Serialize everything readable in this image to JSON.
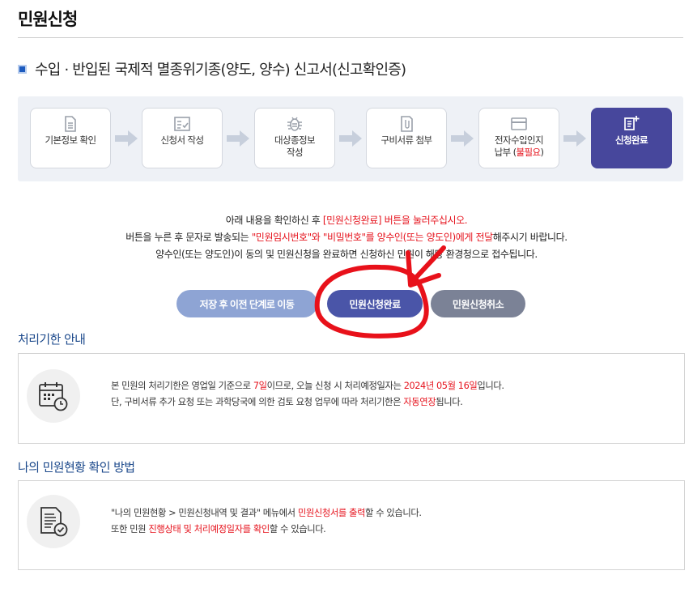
{
  "page_title": "민원신청",
  "form_title": "수입 · 반입된 국제적 멸종위기종(양도, 양수) 신고서(신고확인증)",
  "steps": [
    {
      "label": "기본정보 확인",
      "icon": "document-icon"
    },
    {
      "label": "신청서 작성",
      "icon": "checklist-icon"
    },
    {
      "label_line1": "대상종정보",
      "label_line2": "작성",
      "icon": "bug-icon"
    },
    {
      "label": "구비서류 첨부",
      "icon": "attachment-icon"
    },
    {
      "label_line1": "전자수입인지",
      "label_line2_prefix": "납부 (",
      "label_line2_red": "불필요",
      "label_line2_suffix": ")",
      "icon": "card-icon"
    },
    {
      "label": "신청완료",
      "icon": "note-plus-icon",
      "active": true
    }
  ],
  "notice": {
    "l1_a": "아래 내용을 확인하신 후 ",
    "l1_red": "[민원신청완료] 버튼을 눌러주십시오.",
    "l2_a": "버튼을 누른 후 문자로 발송되는 ",
    "l2_red": "\"민원임시번호\"와 \"비밀번호\"를 양수인(또는 양도인)에게 전달",
    "l2_b": "해주시기 바랍니다.",
    "l3": "양수인(또는 양도인)이 동의 및 민원신청을 완료하면 신청하신 민원이 해당 환경청으로 접수됩니다."
  },
  "buttons": {
    "prev": "저장 후 이전 단계로 이동",
    "complete": "민원신청완료",
    "cancel": "민원신청취소"
  },
  "deadline": {
    "heading": "처리기한 안내",
    "l1_a": "본 민원의 처리기한은 영업일 기준으로 ",
    "l1_red1": "7일",
    "l1_b": "이므로, 오늘 신청 시 처리예정일자는 ",
    "l1_red2": "2024년 05월 16일",
    "l1_c": "입니다.",
    "l2_a": "단, 구비서류 추가 요청 또는 과학당국에 의한 검토 요청 업무에 따라 처리기한은 ",
    "l2_red": "자동연장",
    "l2_b": "됩니다."
  },
  "status": {
    "heading": "나의 민원현황 확인 방법",
    "l1_a": "\"나의 민원현황 > 민원신청내역 및 결과\" 메뉴에서 ",
    "l1_red": "민원신청서를 출력",
    "l1_b": "할 수 있습니다.",
    "l2_a": "또한 민원 ",
    "l2_red": "진행상태 및 처리예정일자를 확인",
    "l2_b": "할 수 있습니다."
  },
  "colors": {
    "accent": "#47479c",
    "highlight_red": "#e6131d",
    "section_heading": "#1d4a8c",
    "annotation_red": "#e8111a"
  }
}
